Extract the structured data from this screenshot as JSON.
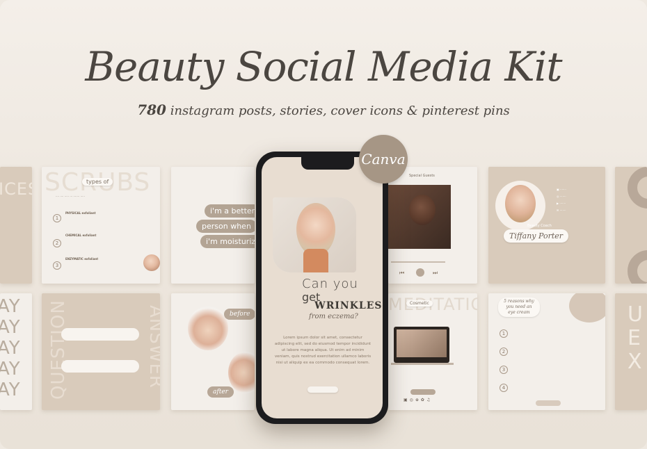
{
  "header": {
    "title": "Beauty Social Media Kit",
    "subtitle_count": "780",
    "subtitle_text": "instagram posts, stories, cover icons & pinterest pins"
  },
  "badge": {
    "label": "Canva"
  },
  "cards": {
    "scrubs": {
      "word": "SCRUBS",
      "pill": "types of",
      "items": [
        "PHYSICAL exfoliant",
        "CHEMICAL exfoliant",
        "ENZYMATIC exfoliant"
      ]
    },
    "better": {
      "lines": [
        "i'm a better",
        "person when",
        "i'm moisturized"
      ]
    },
    "spotify": {
      "header": "Special Guests"
    },
    "tiffany": {
      "tag": "Beauty Coach",
      "name": "Tiffany Porter"
    },
    "question": {
      "word1": "QUESTION",
      "word2": "ANSWER"
    },
    "beforeafter": {
      "before": "before",
      "after": "after"
    },
    "tips": {
      "pill": "5 reasons why you need an eye cream"
    },
    "meditation": {
      "word": "MEDITATION",
      "pill": "Cosmetic"
    },
    "edge_left": {
      "word": "ICES"
    },
    "edge_say": {
      "words": [
        "AY",
        "AY",
        "AY",
        "AY",
        "AY"
      ]
    },
    "edge_right": {
      "letters": [
        "U",
        "E",
        "X"
      ]
    }
  },
  "phone": {
    "headline_1": "Can you",
    "headline_2": "get",
    "headline_3": "WRINKLES",
    "headline_4": "from eczema?",
    "body": "Lorem ipsum dolor sit amet, consectetur adipiscing elit, sed do eiusmod tempor incididunt ut labore magna aliqua. Ut enim ad minim veniam, quis nostrud exercitation ullamco laboris nisi ut aliquip ex ea commodo consequat lorem."
  },
  "colors": {
    "accent": "#a69685",
    "background": "#efe9e1",
    "text": "#4b4641"
  }
}
